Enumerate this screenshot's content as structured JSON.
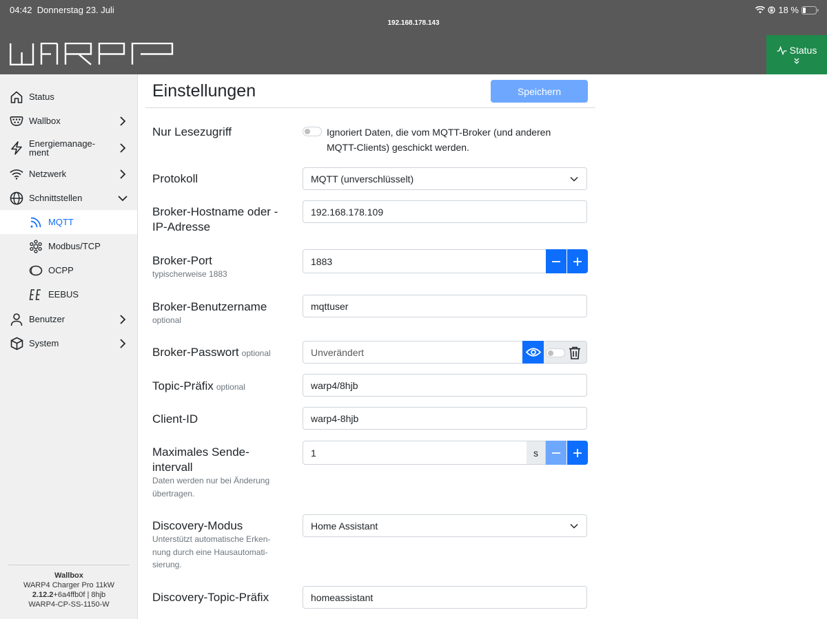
{
  "statusbar": {
    "time": "04:42",
    "date": "Donnerstag 23. Juli",
    "battery": "18 %"
  },
  "url": "192.168.178.143",
  "header": {
    "status_label": "Status"
  },
  "sidebar": {
    "items": [
      {
        "label": "Status",
        "icon": "home-icon"
      },
      {
        "label": "Wallbox",
        "icon": "plug-icon"
      },
      {
        "label": "Energiemanage-\nment",
        "icon": "lightning-icon"
      },
      {
        "label": "Netzwerk",
        "icon": "wifi-icon"
      },
      {
        "label": "Schnittstellen",
        "icon": "globe-icon"
      },
      {
        "label": "MQTT",
        "icon": "rss-icon"
      },
      {
        "label": "Modbus/TCP",
        "icon": "modbus-icon"
      },
      {
        "label": "OCPP",
        "icon": "ocpp-icon"
      },
      {
        "label": "EEBUS",
        "icon": "eebus-icon"
      },
      {
        "label": "Benutzer",
        "icon": "user-icon"
      },
      {
        "label": "System",
        "icon": "cube-icon"
      }
    ],
    "footer": {
      "title": "Wallbox",
      "model": "WARP4 Charger Pro 11kW",
      "version_bold": "2.12.2",
      "version_rest": "+6a4ffb0f | 8hjb",
      "serial": "WARP4-CP-SS-1150-W"
    }
  },
  "main": {
    "title": "Einstellungen",
    "save_label": "Speichern",
    "readonly": {
      "label": "Nur Lesezugriff",
      "desc_1": "Ignoriert Daten, die vom MQTT-Broker (und anderen",
      "desc_2": "MQTT-Clients) geschickt werden."
    },
    "protocol": {
      "label": "Protokoll",
      "value": "MQTT (unverschlüsselt)"
    },
    "hostname": {
      "label_1": "Broker-Hostname oder -",
      "label_2": "IP-Adresse",
      "value": "192.168.178.109"
    },
    "port": {
      "label": "Broker-Port",
      "sub": "typischerweise 1883",
      "value": "1883"
    },
    "username": {
      "label": "Broker-Benutzername",
      "sub": "optional",
      "value": "mqttuser"
    },
    "password": {
      "label": "Broker-Passwort",
      "opt": "optional",
      "placeholder": "Unverändert"
    },
    "topic_prefix": {
      "label": "Topic-Präfix",
      "opt": "optional",
      "value": "warp4/8hjb"
    },
    "client_id": {
      "label": "Client-ID",
      "value": "warp4-8hjb"
    },
    "send_interval": {
      "label_1": "Maximales Sende-",
      "label_2": "intervall",
      "sub_1": "Daten werden nur bei Änderung",
      "sub_2": "übertragen.",
      "value": "1",
      "unit": "s"
    },
    "discovery_mode": {
      "label": "Discovery-Modus",
      "sub_1": "Unterstützt automatische Erken-",
      "sub_2": "nung durch eine Hausautomati-",
      "sub_3": "sierung.",
      "value": "Home Assistant"
    },
    "discovery_prefix": {
      "label": "Discovery-Topic-Präfix",
      "value": "homeassistant"
    }
  },
  "colors": {
    "accent": "#0d6efd",
    "status_green": "#1e8a4c",
    "topbar": "#595959"
  }
}
